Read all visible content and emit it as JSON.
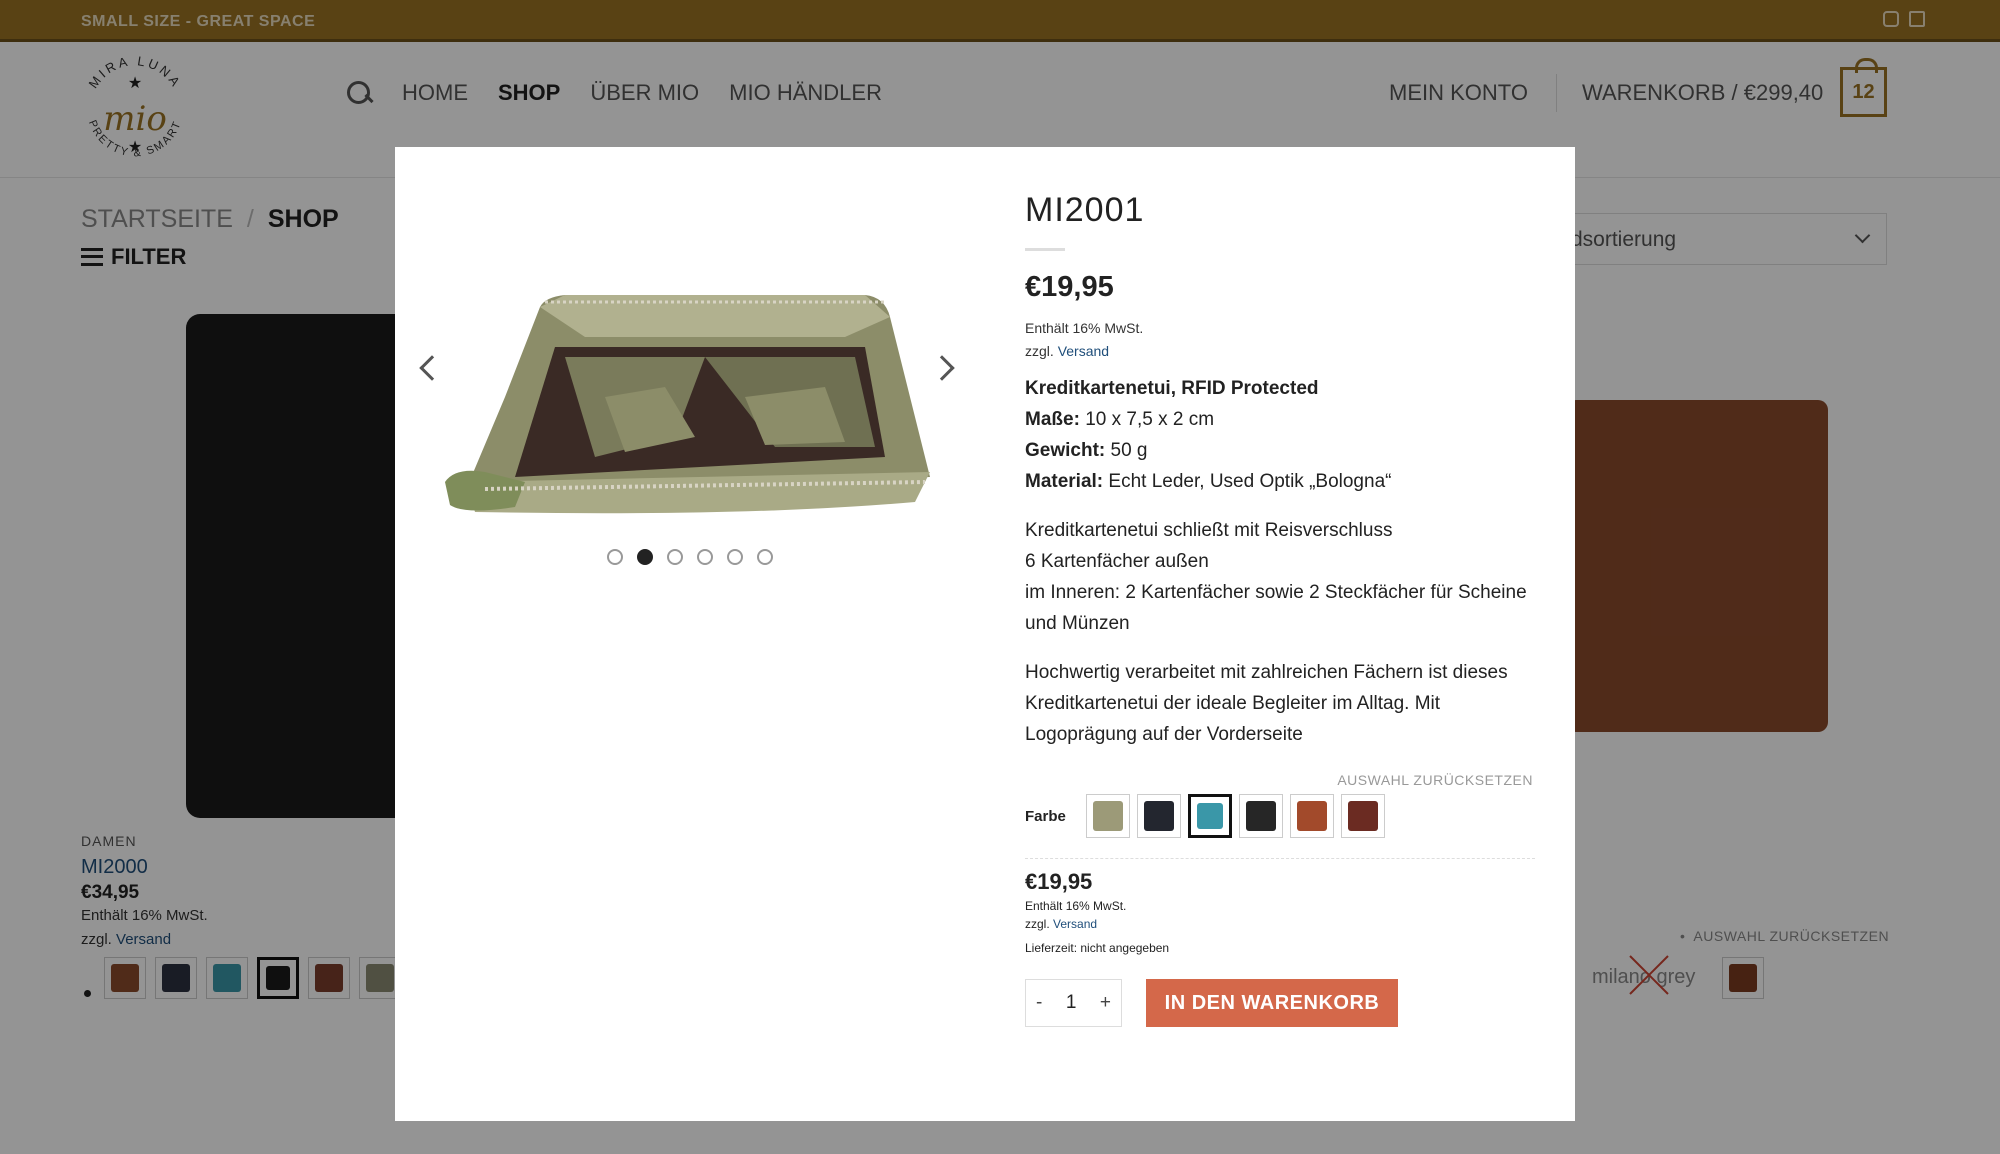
{
  "topbar": {
    "tagline": "SMALL SIZE - GREAT SPACE",
    "icons": [
      "instagram-icon",
      "mail-icon"
    ]
  },
  "logo": {
    "top": "MIRA LUNA",
    "mid": "mio",
    "bottom": "PRETTY & SMART"
  },
  "nav": {
    "items": [
      "HOME",
      "SHOP",
      "ÜBER MIO",
      "MIO HÄNDLER"
    ],
    "active": "SHOP"
  },
  "account": {
    "label": "MEIN KONTO"
  },
  "cart": {
    "label": "WARENKORB / €299,40",
    "count": "12"
  },
  "breadcrumb": {
    "home": "STARTSEITE",
    "sep": "/",
    "current": "SHOP"
  },
  "filter": {
    "label": "FILTER"
  },
  "sort": {
    "label": "dsortierung"
  },
  "background_product": {
    "category": "DAMEN",
    "name": "MI2000",
    "price": "€34,95",
    "tax": "Enthält 16% MwSt.",
    "ship_prefix": "zzgl.",
    "ship_link": "Versand",
    "swatch_colors": [
      "#8a4a2c",
      "#2b3140",
      "#3a97a8",
      "#1b1b1b",
      "#7b3d2b",
      "#8a8a72"
    ],
    "reset_label": "AUSWAHL ZURÜCKSETZEN",
    "milan_label": "milano grey"
  },
  "modal": {
    "title": "MI2001",
    "price": "€19,95",
    "tax": "Enthält 16% MwSt.",
    "ship_prefix": "zzgl.",
    "ship_link": "Versand",
    "specs": {
      "headline": "Kreditkartenetui, RFID Protected",
      "size_label": "Maße:",
      "size_value": "10 x 7,5 x 2 cm",
      "weight_label": "Gewicht:",
      "weight_value": "50 g",
      "material_label": "Material:",
      "material_value": "Echt Leder, Used Optik „Bologna“"
    },
    "desc1": [
      "Kreditkartenetui schließt mit Reisverschluss",
      "6 Kartenfächer außen",
      "im Inneren: 2 Kartenfächer sowie 2 Steckfächer für Scheine",
      "und Münzen"
    ],
    "desc2": [
      "Hochwertig verarbeitet mit zahlreichen Fächern ist dieses",
      "Kreditkartenetui der ideale Begleiter im Alltag. Mit",
      "Logoprägung auf der Vorderseite"
    ],
    "reset_label": "AUSWAHL ZURÜCKSETZEN",
    "color_label": "Farbe",
    "swatches": [
      "#9c9a78",
      "#23262f",
      "#3a97a8",
      "#262626",
      "#a24a2b",
      "#6b2b22"
    ],
    "selected_swatch": 2,
    "price2": "€19,95",
    "tax2": "Enthält 16% MwSt.",
    "ship2_prefix": "zzgl.",
    "ship2_link": "Versand",
    "delivery": "Lieferzeit: nicht angegeben",
    "qty_minus": "-",
    "qty_value": "1",
    "qty_plus": "+",
    "add_button": "IN DEN WARENKORB",
    "image_count": 6,
    "active_image": 1
  },
  "colors": {
    "brand": "#9a7324",
    "button": "#d4684a",
    "link": "#1f4e7a"
  }
}
